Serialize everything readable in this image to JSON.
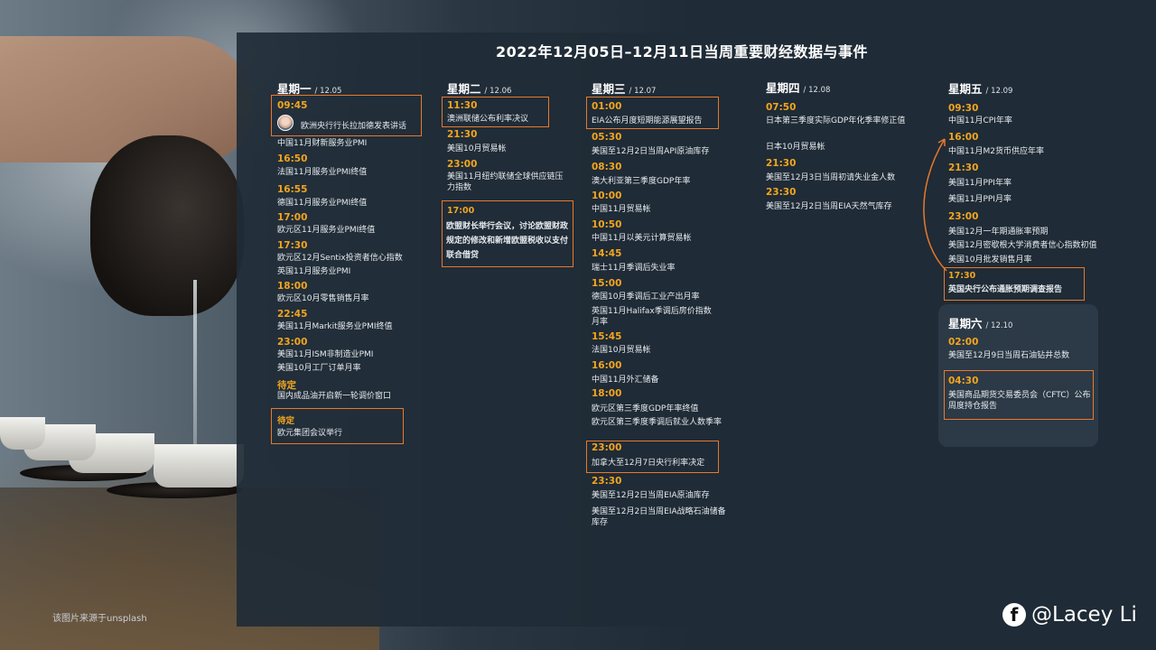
{
  "title": "2022年12月05日–12月11日当周重要财经数据与事件",
  "days": {
    "mon": {
      "name": "星期一",
      "date": "/ 12.05"
    },
    "tue": {
      "name": "星期二",
      "date": "/ 12.06"
    },
    "wed": {
      "name": "星期三",
      "date": "/ 12.07"
    },
    "thu": {
      "name": "星期四",
      "date": "/ 12.08"
    },
    "fri": {
      "name": "星期五",
      "date": "/ 12.09"
    },
    "sat": {
      "name": "星期六",
      "date": "/ 12.10"
    }
  },
  "mon": {
    "t0": "09:45",
    "e0": "欧洲央行行长拉加德发表讲话",
    "e1": "中国11月财新服务业PMI",
    "t2": "16:50",
    "e2": "法国11月服务业PMI终值",
    "t3": "16:55",
    "e3": "德国11月服务业PMI终值",
    "t4": "17:00",
    "e4": "欧元区11月服务业PMI终值",
    "t5": "17:30",
    "e5a": "欧元区12月Sentix投资者信心指数",
    "e5b": "英国11月服务业PMI",
    "t6": "18:00",
    "e6": "欧元区10月零售销售月率",
    "t7": "22:45",
    "e7": "美国11月Markit服务业PMI终值",
    "t8": "23:00",
    "e8a": "美国11月ISM非制造业PMI",
    "e8b": "美国10月工厂订单月率",
    "t9": "待定",
    "e9": "国内成品油开启新一轮调价窗口",
    "t10": "待定",
    "e10": "欧元集团会议举行"
  },
  "tue": {
    "t0": "11:30",
    "e0": "澳洲联储公布利率决议",
    "t1": "21:30",
    "e1": "美国10月贸易帐",
    "t2": "23:00",
    "e2": "美国11月纽约联储全球供应链压力指数",
    "t3": "17:00",
    "e3": "欧盟财长举行会议，讨论欧盟财政规定的修改和新增欧盟税收以支付联合借贷"
  },
  "wed": {
    "t0": "01:00",
    "e0": "EIA公布月度短期能源展望报告",
    "t1": "05:30",
    "e1": "美国至12月2日当周API原油库存",
    "t2": "08:30",
    "e2": "澳大利亚第三季度GDP年率",
    "t3": "10:00",
    "e3": "中国11月贸易帐",
    "t4": "10:50",
    "e4": "中国11月以美元计算贸易帐",
    "t5": "14:45",
    "e5": "瑞士11月季调后失业率",
    "t6": "15:00",
    "e6a": "德国10月季调后工业产出月率",
    "e6b": "英国11月Halifax季调后房价指数月率",
    "t7": "15:45",
    "e7": "法国10月贸易帐",
    "t8": "16:00",
    "e8": "中国11月外汇储备",
    "t9": "18:00",
    "e9a": "欧元区第三季度GDP年率终值",
    "e9b": "欧元区第三季度季调后就业人数季率",
    "t10": "23:00",
    "e10": "加拿大至12月7日央行利率决定",
    "t11": "23:30",
    "e11a": "美国至12月2日当周EIA原油库存",
    "e11b": "美国至12月2日当周EIA战略石油储备库存"
  },
  "thu": {
    "t0": "07:50",
    "e0a": "日本第三季度实际GDP年化季率修正值",
    "e0b": "日本10月贸易帐",
    "t1": "21:30",
    "e1": "美国至12月3日当周初请失业金人数",
    "t2": "23:30",
    "e2": "美国至12月2日当周EIA天然气库存"
  },
  "fri": {
    "t0": "09:30",
    "e0": "中国11月CPI年率",
    "t1": "16:00",
    "e1": "中国11月M2货币供应年率",
    "t2": "21:30",
    "e2a": "美国11月PPI年率",
    "e2b": "美国11月PPI月率",
    "t3": "23:00",
    "e3a": "美国12月一年期通胀率预期",
    "e3b": "美国12月密歇根大学消费者信心指数初值",
    "e3c": "美国10月批发销售月率",
    "t4": "17:30",
    "e4": "英国央行公布通胀预期调查报告"
  },
  "sat": {
    "t0": "02:00",
    "e0": "美国至12月9日当周石油钻井总数",
    "t1": "04:30",
    "e1": "美国商品期货交易委员会（CFTC）公布周度持仓报告"
  },
  "footnote": "该图片来源于unsplash",
  "brand": {
    "icon": "facebook-icon",
    "handle": "@Lacey Li"
  },
  "colors": {
    "time": "#f3a51f",
    "highlight": "#e9782c",
    "panel": "#1f2b36"
  }
}
